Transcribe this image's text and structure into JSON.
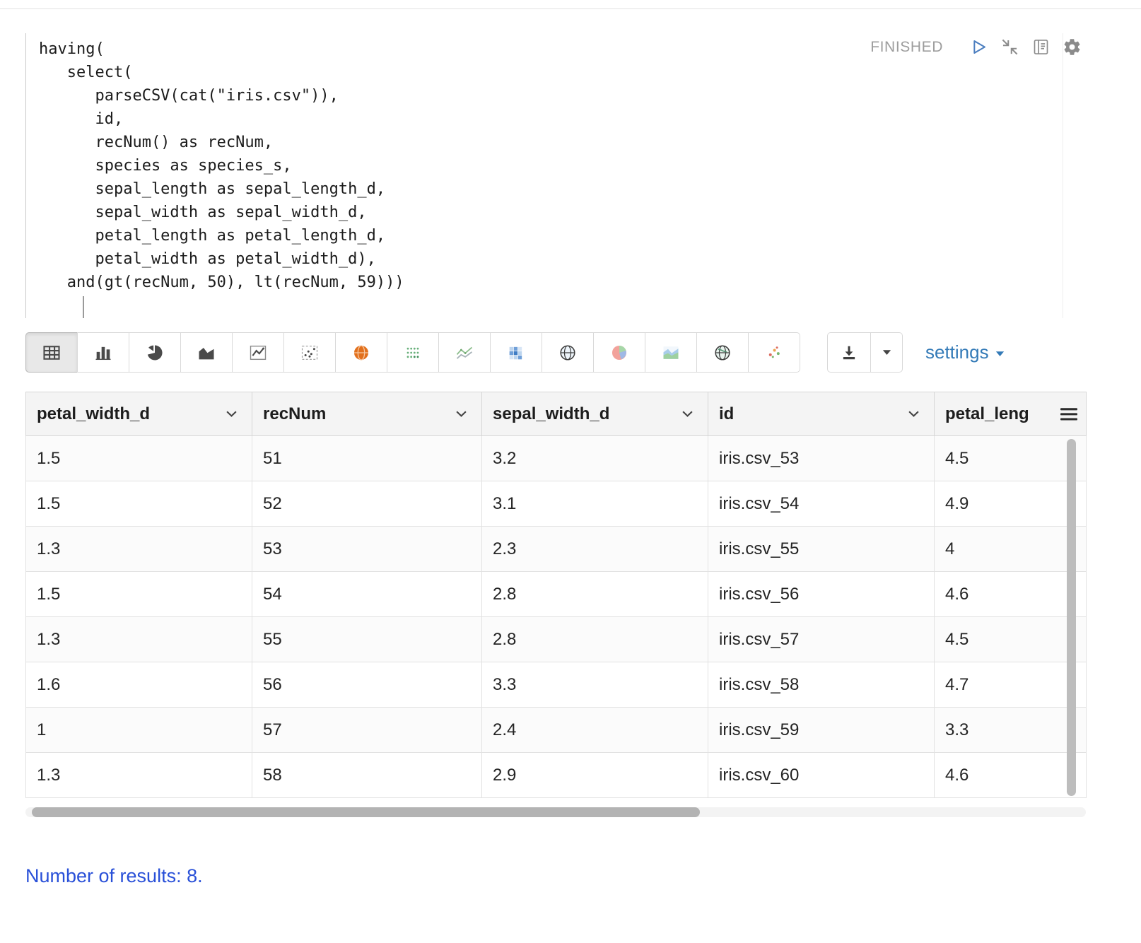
{
  "editor": {
    "code": "having(\n   select(\n      parseCSV(cat(\"iris.csv\")),\n      id,\n      recNum() as recNum,\n      species as species_s,\n      sepal_length as sepal_length_d,\n      sepal_width as sepal_width_d,\n      petal_length as petal_length_d,\n      petal_width as petal_width_d),\n   and(gt(recNum, 50), lt(recNum, 59)))"
  },
  "status": {
    "label": "FINISHED"
  },
  "toolbar": {
    "viz_buttons": [
      {
        "name": "table-view",
        "icon": "table-icon",
        "active": true
      },
      {
        "name": "bar-chart",
        "icon": "bar-chart-icon",
        "active": false
      },
      {
        "name": "pie-chart",
        "icon": "pie-chart-icon",
        "active": false
      },
      {
        "name": "area-chart",
        "icon": "area-chart-icon",
        "active": false
      },
      {
        "name": "line-chart",
        "icon": "line-chart-icon",
        "active": false
      },
      {
        "name": "scatter-chart",
        "icon": "scatter-chart-icon",
        "active": false
      },
      {
        "name": "map-viz",
        "icon": "globe-orange-icon",
        "active": false
      },
      {
        "name": "dot-matrix-viz",
        "icon": "dot-grid-icon",
        "active": false
      },
      {
        "name": "multi-line-viz",
        "icon": "multi-line-chart-icon",
        "active": false
      },
      {
        "name": "heatmap-viz",
        "icon": "heatmap-icon",
        "active": false
      },
      {
        "name": "globe-viz",
        "icon": "globe-icon",
        "active": false
      },
      {
        "name": "color-pie-viz",
        "icon": "pie-color-icon",
        "active": false
      },
      {
        "name": "color-area-viz",
        "icon": "area-color-icon",
        "active": false
      },
      {
        "name": "globe-alt-viz",
        "icon": "globe2-icon",
        "active": false
      },
      {
        "name": "color-scatter-viz",
        "icon": "scatter-color-icon",
        "active": false
      }
    ],
    "settings_label": "settings"
  },
  "table": {
    "columns": [
      {
        "label": "petal_width_d",
        "control": "dropdown"
      },
      {
        "label": "recNum",
        "control": "dropdown"
      },
      {
        "label": "sepal_width_d",
        "control": "dropdown"
      },
      {
        "label": "id",
        "control": "dropdown"
      },
      {
        "label": "petal_leng",
        "control": "menu"
      }
    ],
    "rows": [
      [
        "1.5",
        "51",
        "3.2",
        "iris.csv_53",
        "4.5"
      ],
      [
        "1.5",
        "52",
        "3.1",
        "iris.csv_54",
        "4.9"
      ],
      [
        "1.3",
        "53",
        "2.3",
        "iris.csv_55",
        "4"
      ],
      [
        "1.5",
        "54",
        "2.8",
        "iris.csv_56",
        "4.6"
      ],
      [
        "1.3",
        "55",
        "2.8",
        "iris.csv_57",
        "4.5"
      ],
      [
        "1.6",
        "56",
        "3.3",
        "iris.csv_58",
        "4.7"
      ],
      [
        "1",
        "57",
        "2.4",
        "iris.csv_59",
        "3.3"
      ],
      [
        "1.3",
        "58",
        "2.9",
        "iris.csv_60",
        "4.6"
      ]
    ]
  },
  "footer": {
    "results_text": "Number of results: 8."
  },
  "colors": {
    "settings_link": "#337ab7",
    "results_text": "#2950d8",
    "status_text": "#9d9d9d",
    "accent_orange": "#e2701c"
  }
}
